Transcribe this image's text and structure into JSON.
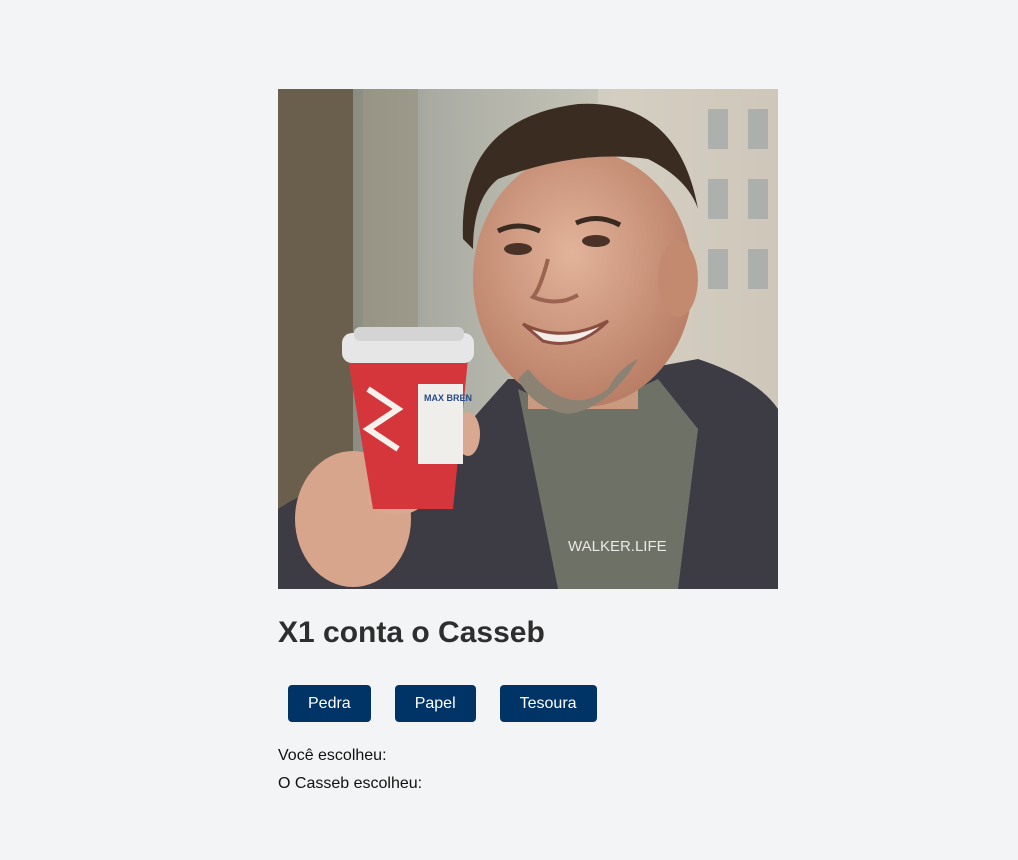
{
  "page": {
    "photo_alt": "Foto do Casseb segurando um copo de café",
    "shirt_text": "WALKER.LIFE",
    "cup_text": "MAX BREN",
    "title": "X1 conta o Casseb"
  },
  "buttons": {
    "rock_label": "Pedra",
    "paper_label": "Papel",
    "scissors_label": "Tesoura"
  },
  "results": {
    "player_label": "Você escolheu:",
    "player_choice": "",
    "casseb_label": "O Casseb escolheu:",
    "casseb_choice": ""
  },
  "colors": {
    "background": "#f2f4f6",
    "button": "#003366",
    "button_text": "#ffffff",
    "title": "#2e2e2e"
  }
}
